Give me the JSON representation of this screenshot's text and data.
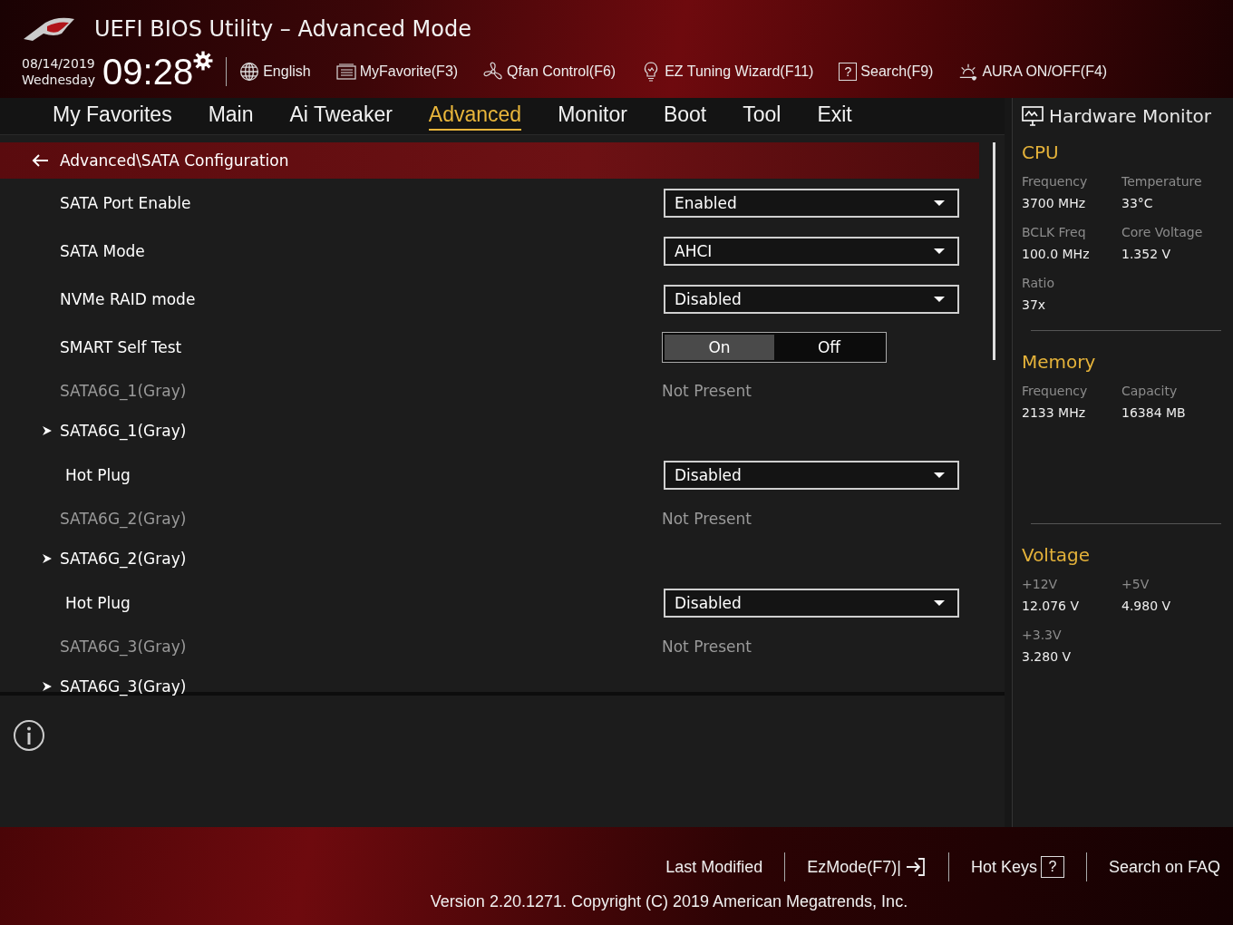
{
  "header": {
    "title": "UEFI BIOS Utility – Advanced Mode",
    "date": "08/14/2019",
    "day": "Wednesday",
    "time": "09:28",
    "tools": [
      {
        "kind": "language",
        "label": "English"
      },
      {
        "kind": "favorite",
        "label": "MyFavorite(F3)"
      },
      {
        "kind": "fan",
        "label": "Qfan Control(F6)"
      },
      {
        "kind": "wizard",
        "label": "EZ Tuning Wizard(F11)"
      },
      {
        "kind": "search",
        "label": "Search(F9)",
        "icon": "?"
      },
      {
        "kind": "aura",
        "label": "AURA ON/OFF(F4)"
      }
    ]
  },
  "tabs": [
    {
      "label": "My Favorites",
      "selected": false
    },
    {
      "label": "Main",
      "selected": false
    },
    {
      "label": "Ai Tweaker",
      "selected": false
    },
    {
      "label": "Advanced",
      "selected": true
    },
    {
      "label": "Monitor",
      "selected": false
    },
    {
      "label": "Boot",
      "selected": false
    },
    {
      "label": "Tool",
      "selected": false
    },
    {
      "label": "Exit",
      "selected": false
    }
  ],
  "breadcrumb": "Advanced\\SATA Configuration",
  "settings": [
    {
      "kind": "dropdown",
      "label": "SATA Port Enable",
      "value": "Enabled"
    },
    {
      "kind": "dropdown",
      "label": "SATA Mode",
      "value": "AHCI"
    },
    {
      "kind": "dropdown",
      "label": "NVMe RAID mode",
      "value": "Disabled"
    },
    {
      "kind": "toggle",
      "label": "SMART Self Test",
      "options": [
        {
          "label": "On",
          "selected": true
        },
        {
          "label": "Off",
          "selected": false
        }
      ]
    },
    {
      "kind": "info",
      "label": "SATA6G_1(Gray)",
      "value": "Not Present"
    },
    {
      "kind": "submenu",
      "label": "SATA6G_1(Gray)",
      "children": [
        {
          "kind": "dropdown",
          "label": "Hot Plug",
          "value": "Disabled"
        }
      ]
    },
    {
      "kind": "info",
      "label": "SATA6G_2(Gray)",
      "value": "Not Present"
    },
    {
      "kind": "submenu",
      "label": "SATA6G_2(Gray)",
      "children": [
        {
          "kind": "dropdown",
          "label": "Hot Plug",
          "value": "Disabled"
        }
      ]
    },
    {
      "kind": "info",
      "label": "SATA6G_3(Gray)",
      "value": "Not Present"
    },
    {
      "kind": "submenu",
      "label": "SATA6G_3(Gray)"
    }
  ],
  "hardware_monitor": {
    "title": "Hardware Monitor",
    "sections": [
      {
        "title": "CPU",
        "stats": [
          {
            "label": "Frequency",
            "value": "3700 MHz"
          },
          {
            "label": "Temperature",
            "value": "33°C"
          },
          {
            "label": "BCLK Freq",
            "value": "100.0 MHz"
          },
          {
            "label": "Core Voltage",
            "value": "1.352 V"
          },
          {
            "label": "Ratio",
            "value": "37x"
          }
        ]
      },
      {
        "title": "Memory",
        "stats": [
          {
            "label": "Frequency",
            "value": "2133 MHz"
          },
          {
            "label": "Capacity",
            "value": "16384 MB"
          }
        ]
      },
      {
        "title": "Voltage",
        "stats": [
          {
            "label": "+12V",
            "value": "12.076 V"
          },
          {
            "label": "+5V",
            "value": "4.980 V"
          },
          {
            "label": "+3.3V",
            "value": "3.280 V"
          }
        ]
      }
    ]
  },
  "footer": {
    "links": [
      {
        "kind": "plain",
        "label": "Last Modified"
      },
      {
        "kind": "ezmode",
        "label": "EzMode(F7)|"
      },
      {
        "kind": "hotkeys",
        "label": "Hot Keys",
        "icon": "?"
      },
      {
        "kind": "plain",
        "label": "Search on FAQ"
      }
    ],
    "version": "Version 2.20.1271. Copyright (C) 2019 American Megatrends, Inc."
  }
}
